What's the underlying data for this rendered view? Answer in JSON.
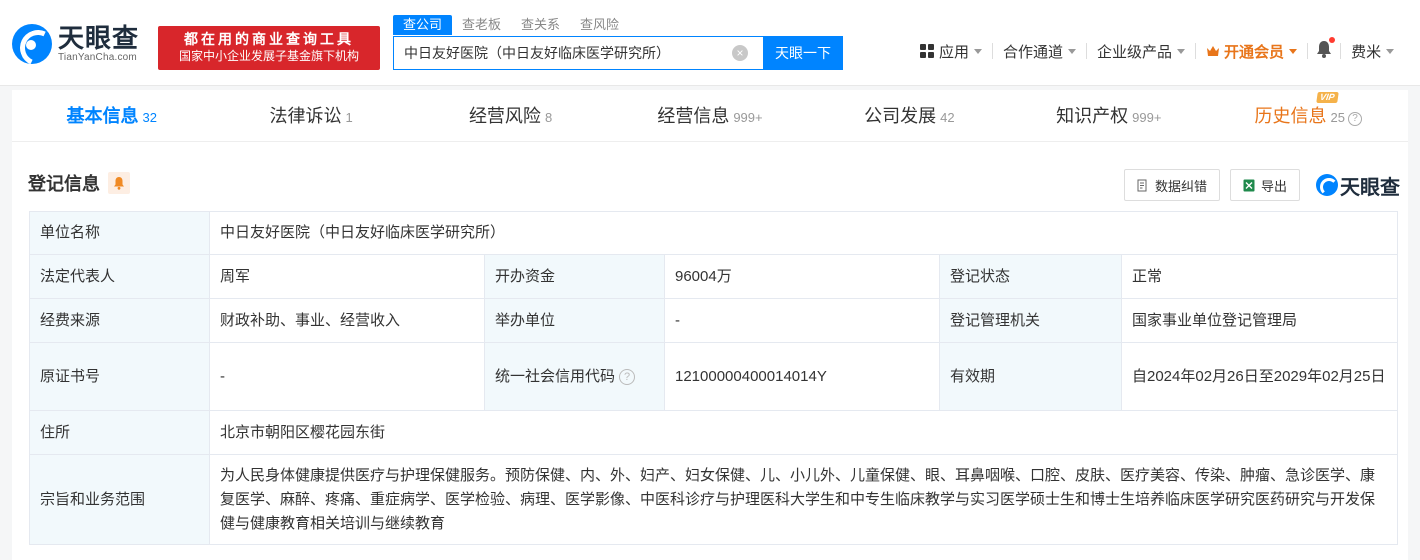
{
  "brand": {
    "name_cn": "天眼查",
    "name_en": "TianYanCha.com",
    "promo_line1": "都在用的商业查询工具",
    "promo_line2": "国家中小企业发展子基金旗下机构",
    "small_name": "天眼查"
  },
  "search": {
    "tabs": [
      "查公司",
      "查老板",
      "查关系",
      "查风险"
    ],
    "active_tab": "查公司",
    "query": "中日友好医院（中日友好临床医学研究所）",
    "button": "天眼一下",
    "clear": "×"
  },
  "topnav": {
    "apps": "应用",
    "channels": "合作通道",
    "enterprise": "企业级产品",
    "vip": "开通会员",
    "user": "费米"
  },
  "tabs": [
    {
      "label": "基本信息",
      "count": "32"
    },
    {
      "label": "法律诉讼",
      "count": "1"
    },
    {
      "label": "经营风险",
      "count": "8"
    },
    {
      "label": "经营信息",
      "count": "999+"
    },
    {
      "label": "公司发展",
      "count": "42"
    },
    {
      "label": "知识产权",
      "count": "999+"
    },
    {
      "label": "历史信息",
      "count": "25",
      "tag": "VIP",
      "help": "?"
    }
  ],
  "section": {
    "title": "登记信息",
    "correction_btn": "数据纠错",
    "export_btn": "导出"
  },
  "table": {
    "unit_name_key": "单位名称",
    "unit_name": "中日友好医院（中日友好临床医学研究所）",
    "legal_rep_key": "法定代表人",
    "legal_rep": "周军",
    "capital_key": "开办资金",
    "capital": "96004万",
    "reg_status_key": "登记状态",
    "reg_status": "正常",
    "funding_key": "经费来源",
    "funding": "财政补助、事业、经营收入",
    "sponsor_key": "举办单位",
    "sponsor": "-",
    "authority_key": "登记管理机关",
    "authority": "国家事业单位登记管理局",
    "cert_key": "原证书号",
    "cert": "-",
    "credit_code_key": "统一社会信用代码",
    "credit_code": "12100000400014014Y",
    "validity_key": "有效期",
    "validity": "自2024年02月26日至2029年02月25日",
    "address_key": "住所",
    "address": "北京市朝阳区樱花园东街",
    "scope_key": "宗旨和业务范围",
    "scope": "为人民身体健康提供医疗与护理保健服务。预防保健、内、外、妇产、妇女保健、儿、小儿外、儿童保健、眼、耳鼻咽喉、口腔、皮肤、医疗美容、传染、肿瘤、急诊医学、康复医学、麻醉、疼痛、重症病学、医学检验、病理、医学影像、中医科诊疗与护理医科大学生和中专生临床教学与实习医学硕士生和博士生培养临床医学研究医药研究与开发保健与健康教育相关培训与继续教育"
  },
  "colors": {
    "accent": "#0084ff",
    "promo": "#d8262b",
    "vip": "#e8751a",
    "label_bg": "#f2f9fc"
  }
}
